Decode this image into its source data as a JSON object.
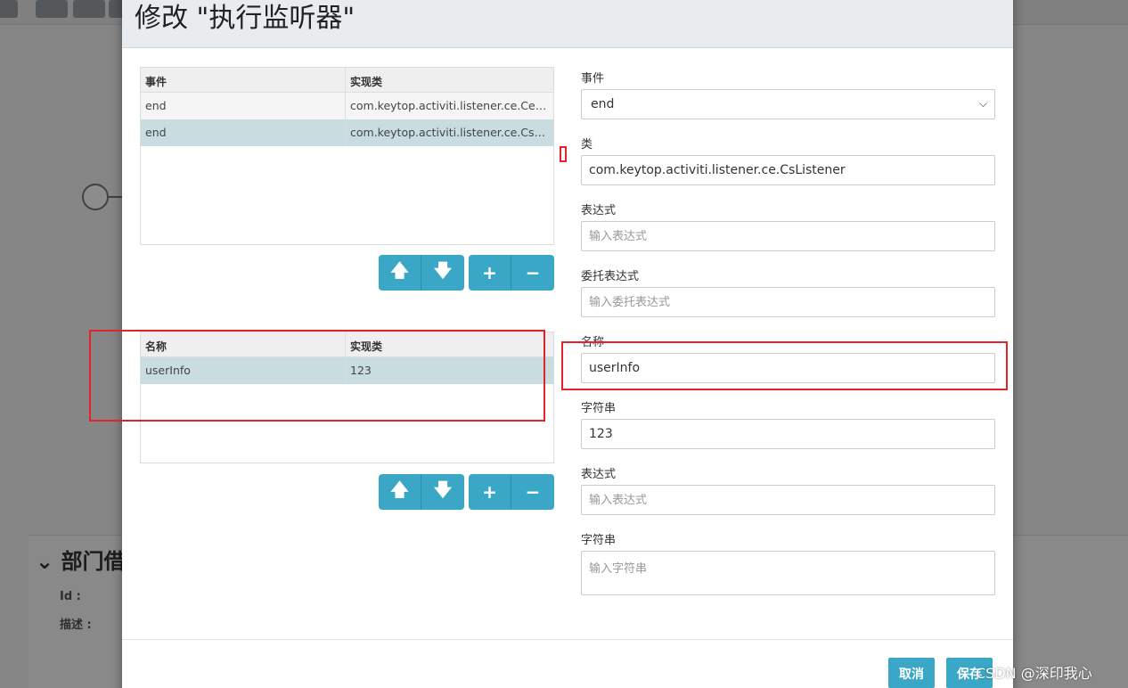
{
  "background": {
    "panel_title": "部门借",
    "fields": [
      "Id :",
      "描述 :"
    ]
  },
  "dialog": {
    "title": "修改 \"执行监听器\""
  },
  "listeners_table": {
    "headers": [
      "事件",
      "实现类"
    ],
    "rows": [
      {
        "event": "end",
        "impl": "com.keytop.activiti.listener.ce.CeDelete..."
      },
      {
        "event": "end",
        "impl": "com.keytop.activiti.listener.ce.CsListener"
      }
    ]
  },
  "fields_table": {
    "headers": [
      "名称",
      "实现类"
    ],
    "rows": [
      {
        "name": "userInfo",
        "impl": "123"
      }
    ]
  },
  "buttons": {
    "up": "🡅",
    "down": "🡇",
    "add": "+",
    "remove": "−"
  },
  "form": {
    "event_label": "事件",
    "event_value": "end",
    "class_label": "类",
    "class_value": "com.keytop.activiti.listener.ce.CsListener",
    "expression_label": "表达式",
    "expression_placeholder": "输入表达式",
    "delegate_label": "委托表达式",
    "delegate_placeholder": "输入委托表达式",
    "name_label": "名称",
    "name_value": "userInfo",
    "string_label": "字符串",
    "string_value": "123",
    "expression2_label": "表达式",
    "expression2_placeholder": "输入表达式",
    "string2_label": "字符串",
    "string2_placeholder": "输入字符串"
  },
  "footer": {
    "cancel": "取消",
    "save": "保存"
  },
  "watermark": "CSDN @深印我心",
  "colors": {
    "accent": "#39a7c5",
    "selected_row": "#c9dde1",
    "annotation_red": "#e0242b"
  }
}
